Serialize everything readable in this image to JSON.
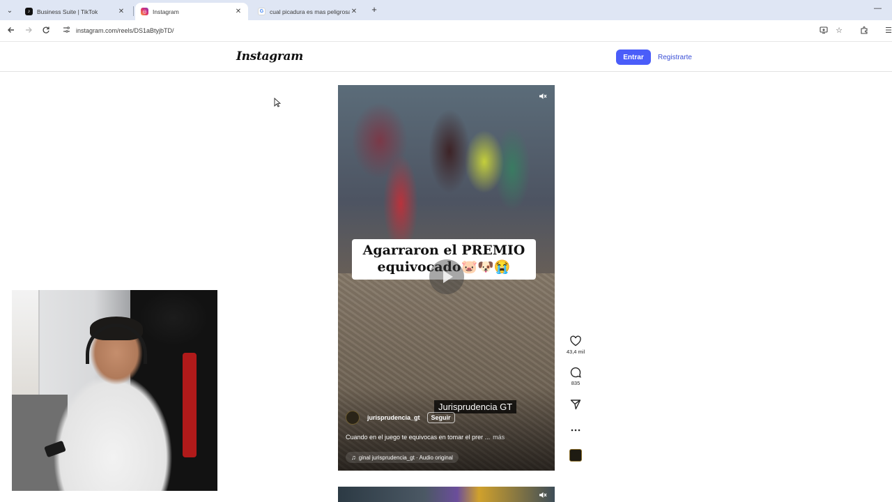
{
  "browser": {
    "tabs": [
      {
        "title": "Business Suite | TikTok",
        "favicon": "tiktok-icon",
        "favicon_color": "#111111",
        "active": false
      },
      {
        "title": "Instagram",
        "favicon": "instagram-icon",
        "favicon_color": "#e1306c",
        "active": true
      },
      {
        "title": "cual picadura es mas peligrosa",
        "favicon": "google-icon",
        "favicon_color": "#4285f4",
        "active": false
      }
    ],
    "close_glyph": "✕",
    "new_tab_glyph": "+",
    "minimize_glyph": "—",
    "url": "instagram.com/reels/DS1aBtyjbTD/"
  },
  "instagram": {
    "logo": "Instagram",
    "login_label": "Entrar",
    "signup_label": "Registrarte",
    "accent_color": "#4a5df9"
  },
  "reel": {
    "caption_line1": "Agarraron el PREMIO",
    "caption_line2": "equivocado🐷🐶😭",
    "watermark": "Jurisprudencia GT",
    "author": "jurisprudencia_gt",
    "follow_label": "Seguir",
    "description": "Cuando en el juego te equivocas en tomar el prer ...",
    "more_label": "más",
    "audio": "ginal  jurisprudencia_gt · Audio original"
  },
  "actions": {
    "likes": "43,4 mil",
    "comments": "835"
  }
}
